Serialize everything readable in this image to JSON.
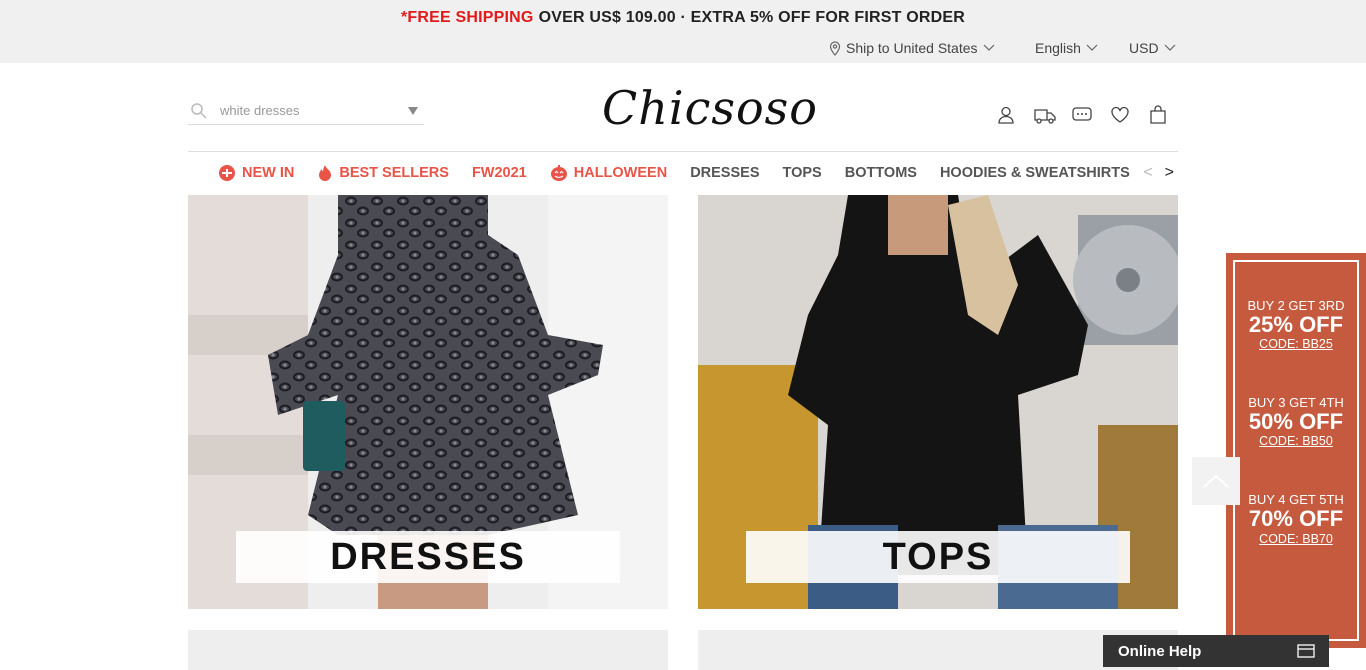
{
  "banner": {
    "highlight": "*FREE SHIPPING",
    "rest": "OVER US$ 109.00 · EXTRA 5% OFF FOR FIRST ORDER"
  },
  "util": {
    "ship": "Ship to United States",
    "language": "English",
    "currency": "USD"
  },
  "search": {
    "placeholder": "white dresses"
  },
  "logo": "Chicsoso",
  "header_icons": [
    "user-icon",
    "truck-icon",
    "chat-icon",
    "heart-icon",
    "bag-icon"
  ],
  "nav": {
    "items": [
      {
        "label": "NEW IN",
        "icon": "new-badge-icon"
      },
      {
        "label": "BEST SELLERS",
        "icon": "fire-icon"
      },
      {
        "label": "FW2021"
      },
      {
        "label": "HALLOWEEN",
        "icon": "pumpkin-icon"
      },
      {
        "label": "DRESSES"
      },
      {
        "label": "TOPS"
      },
      {
        "label": "BOTTOMS"
      },
      {
        "label": "HOODIES & SWEATSHIRTS"
      }
    ],
    "prev": "<",
    "next": ">"
  },
  "tiles": [
    {
      "label": "DRESSES"
    },
    {
      "label": "TOPS"
    }
  ],
  "promo": [
    {
      "l1": "BUY 2 GET 3RD",
      "l2": "25% OFF",
      "l3": "CODE: BB25"
    },
    {
      "l1": "BUY 3 GET 4TH",
      "l2": "50% OFF",
      "l3": "CODE: BB50"
    },
    {
      "l1": "BUY 4 GET 5TH",
      "l2": "70% OFF",
      "l3": "CODE: BB70"
    }
  ],
  "online_help": "Online Help",
  "colors": {
    "accent": "#e85548",
    "banner_red": "#e21a1a",
    "promo_bg": "#c55a3f"
  }
}
